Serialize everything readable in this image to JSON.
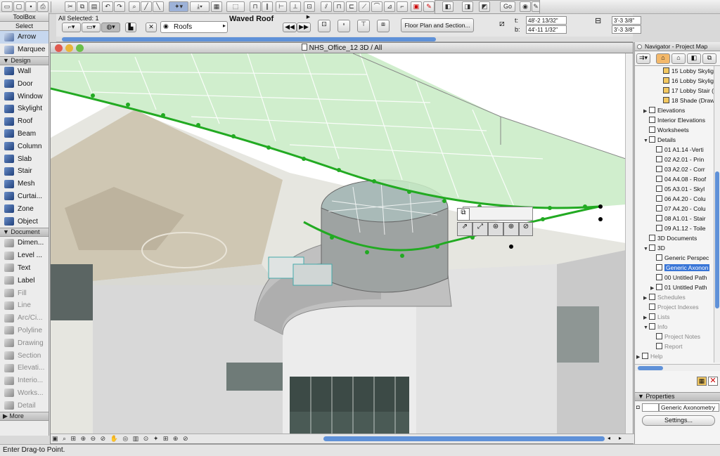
{
  "colors": {
    "accent": "#3875d7",
    "roof_glass": "#c8ebc4",
    "selection": "#22aa22"
  },
  "toolbar": {
    "icons": [
      "new-icon",
      "open-icon",
      "save-icon",
      "print-icon",
      "undo-icon",
      "redo-icon",
      "cut-icon",
      "copy-icon",
      "paste-icon",
      "find-icon",
      "eyedropper-icon",
      "syringe-icon",
      "magic-wand-icon",
      "gravity-icon",
      "grid-snap-icon",
      "layer-icon",
      "align-icon",
      "distribute-icon",
      "dimension-icon",
      "mirror-icon",
      "rotate-icon",
      "elevate-icon",
      "trace-icon",
      "show-icon",
      "pen-icon",
      "floor-plan-icon",
      "section-icon",
      "3d-window-icon",
      "go-icon",
      "navigator-icon",
      "pointer-icon"
    ],
    "go_label": "Go"
  },
  "infobox": {
    "all_selected": "All Selected: 1",
    "layer": "Roofs",
    "element_name": "Waved Roof",
    "view_button": "Floor Plan and Section...",
    "t_label": "t:",
    "t_value": "48'-2 13/32\"",
    "b_label": "b:",
    "b_value": "44'-11 1/32\"",
    "dim1": "3'-3 3/8\"",
    "dim2": "3'-3 3/8\""
  },
  "toolbox": {
    "title": "ToolBox",
    "select_header": "Select",
    "select_tools": [
      {
        "label": "Arrow",
        "icon": "arrow-icon"
      },
      {
        "label": "Marquee",
        "icon": "marquee-icon"
      }
    ],
    "design_header": "Design",
    "design_tools": [
      {
        "label": "Wall",
        "icon": "wall-icon"
      },
      {
        "label": "Door",
        "icon": "door-icon"
      },
      {
        "label": "Window",
        "icon": "window-icon"
      },
      {
        "label": "Skylight",
        "icon": "skylight-icon"
      },
      {
        "label": "Roof",
        "icon": "roof-icon"
      },
      {
        "label": "Beam",
        "icon": "beam-icon"
      },
      {
        "label": "Column",
        "icon": "column-icon"
      },
      {
        "label": "Slab",
        "icon": "slab-icon"
      },
      {
        "label": "Stair",
        "icon": "stair-icon"
      },
      {
        "label": "Mesh",
        "icon": "mesh-icon"
      },
      {
        "label": "Curtai...",
        "icon": "curtain-wall-icon"
      },
      {
        "label": "Zone",
        "icon": "zone-icon"
      },
      {
        "label": "Object",
        "icon": "object-icon"
      }
    ],
    "document_header": "Document",
    "document_tools": [
      {
        "label": "Dimen...",
        "icon": "dimension-icon"
      },
      {
        "label": "Level ...",
        "icon": "level-icon"
      },
      {
        "label": "Text",
        "icon": "text-icon"
      },
      {
        "label": "Label",
        "icon": "label-icon"
      },
      {
        "label": "Fill",
        "icon": "fill-icon"
      },
      {
        "label": "Line",
        "icon": "line-icon"
      },
      {
        "label": "Arc/Ci...",
        "icon": "arc-icon"
      },
      {
        "label": "Polyline",
        "icon": "polyline-icon"
      },
      {
        "label": "Drawing",
        "icon": "drawing-icon"
      },
      {
        "label": "Section",
        "icon": "section-icon"
      },
      {
        "label": "Elevati...",
        "icon": "elevation-icon"
      },
      {
        "label": "Interio...",
        "icon": "interior-icon"
      },
      {
        "label": "Works...",
        "icon": "worksheet-icon"
      },
      {
        "label": "Detail",
        "icon": "detail-icon"
      }
    ],
    "more_header": "More"
  },
  "window": {
    "title": "NHS_Office_12 3D / All"
  },
  "navigator": {
    "title": "Navigator - Project Map",
    "items": [
      {
        "label": "15 Lobby Skylig",
        "indent": 3,
        "icon": "roof-icon"
      },
      {
        "label": "16 Lobby Skylig",
        "indent": 3,
        "icon": "roof-icon"
      },
      {
        "label": "17 Lobby Stair (",
        "indent": 3,
        "icon": "roof-icon"
      },
      {
        "label": "18 Shade (Drawi",
        "indent": 3,
        "icon": "roof-icon"
      },
      {
        "label": "Elevations",
        "indent": 1,
        "icon": "elevation-icon",
        "tri": "▶"
      },
      {
        "label": "Interior Elevations",
        "indent": 1,
        "icon": "interior-icon"
      },
      {
        "label": "Worksheets",
        "indent": 1,
        "icon": "worksheet-icon"
      },
      {
        "label": "Details",
        "indent": 1,
        "icon": "detail-icon",
        "tri": "▼"
      },
      {
        "label": "01 A1.14 -Verti",
        "indent": 2,
        "icon": "detail-icon"
      },
      {
        "label": "02 A2.01 - Prin",
        "indent": 2,
        "icon": "detail-icon"
      },
      {
        "label": "03 A2.02 - Corr",
        "indent": 2,
        "icon": "detail-icon"
      },
      {
        "label": "04 A4.08 - Roof",
        "indent": 2,
        "icon": "detail-icon"
      },
      {
        "label": "05 A3.01 - Skyl",
        "indent": 2,
        "icon": "detail-icon"
      },
      {
        "label": "06 A4.20 - Colu",
        "indent": 2,
        "icon": "detail-icon"
      },
      {
        "label": "07 A4.20 - Colu",
        "indent": 2,
        "icon": "detail-icon"
      },
      {
        "label": "08 A1.01 - Stair",
        "indent": 2,
        "icon": "detail-icon"
      },
      {
        "label": "09 A1.12 - Toile",
        "indent": 2,
        "icon": "detail-icon"
      },
      {
        "label": "3D Documents",
        "indent": 1,
        "icon": "3d-document-icon"
      },
      {
        "label": "3D",
        "indent": 1,
        "icon": "3d-icon",
        "tri": "▼"
      },
      {
        "label": "Generic Perspec",
        "indent": 2,
        "icon": "perspective-icon"
      },
      {
        "label": "Generic Axonon",
        "indent": 2,
        "icon": "axonometry-icon",
        "selected": true
      },
      {
        "label": "00 Untitled Path",
        "indent": 2,
        "icon": "path-icon"
      },
      {
        "label": "01 Untitled Path",
        "indent": 2,
        "icon": "path-icon",
        "tri": "▶"
      },
      {
        "label": "Schedules",
        "indent": 1,
        "icon": "schedule-icon",
        "tri": "▶",
        "dim": true
      },
      {
        "label": "Project Indexes",
        "indent": 1,
        "icon": "index-icon",
        "dim": true
      },
      {
        "label": "Lists",
        "indent": 1,
        "icon": "list-icon",
        "tri": "▶",
        "dim": true
      },
      {
        "label": "Info",
        "indent": 1,
        "icon": "info-icon",
        "tri": "▼",
        "dim": true
      },
      {
        "label": "Project Notes",
        "indent": 2,
        "icon": "notes-icon",
        "dim": true
      },
      {
        "label": "Report",
        "indent": 2,
        "icon": "report-icon",
        "dim": true
      },
      {
        "label": "Help",
        "indent": 0,
        "icon": "help-icon",
        "tri": "▶",
        "dim": true
      }
    ],
    "properties_header": "Properties",
    "properties_value": "Generic Axonometry",
    "settings_button": "Settings..."
  },
  "status": "Enter Drag-to Point."
}
